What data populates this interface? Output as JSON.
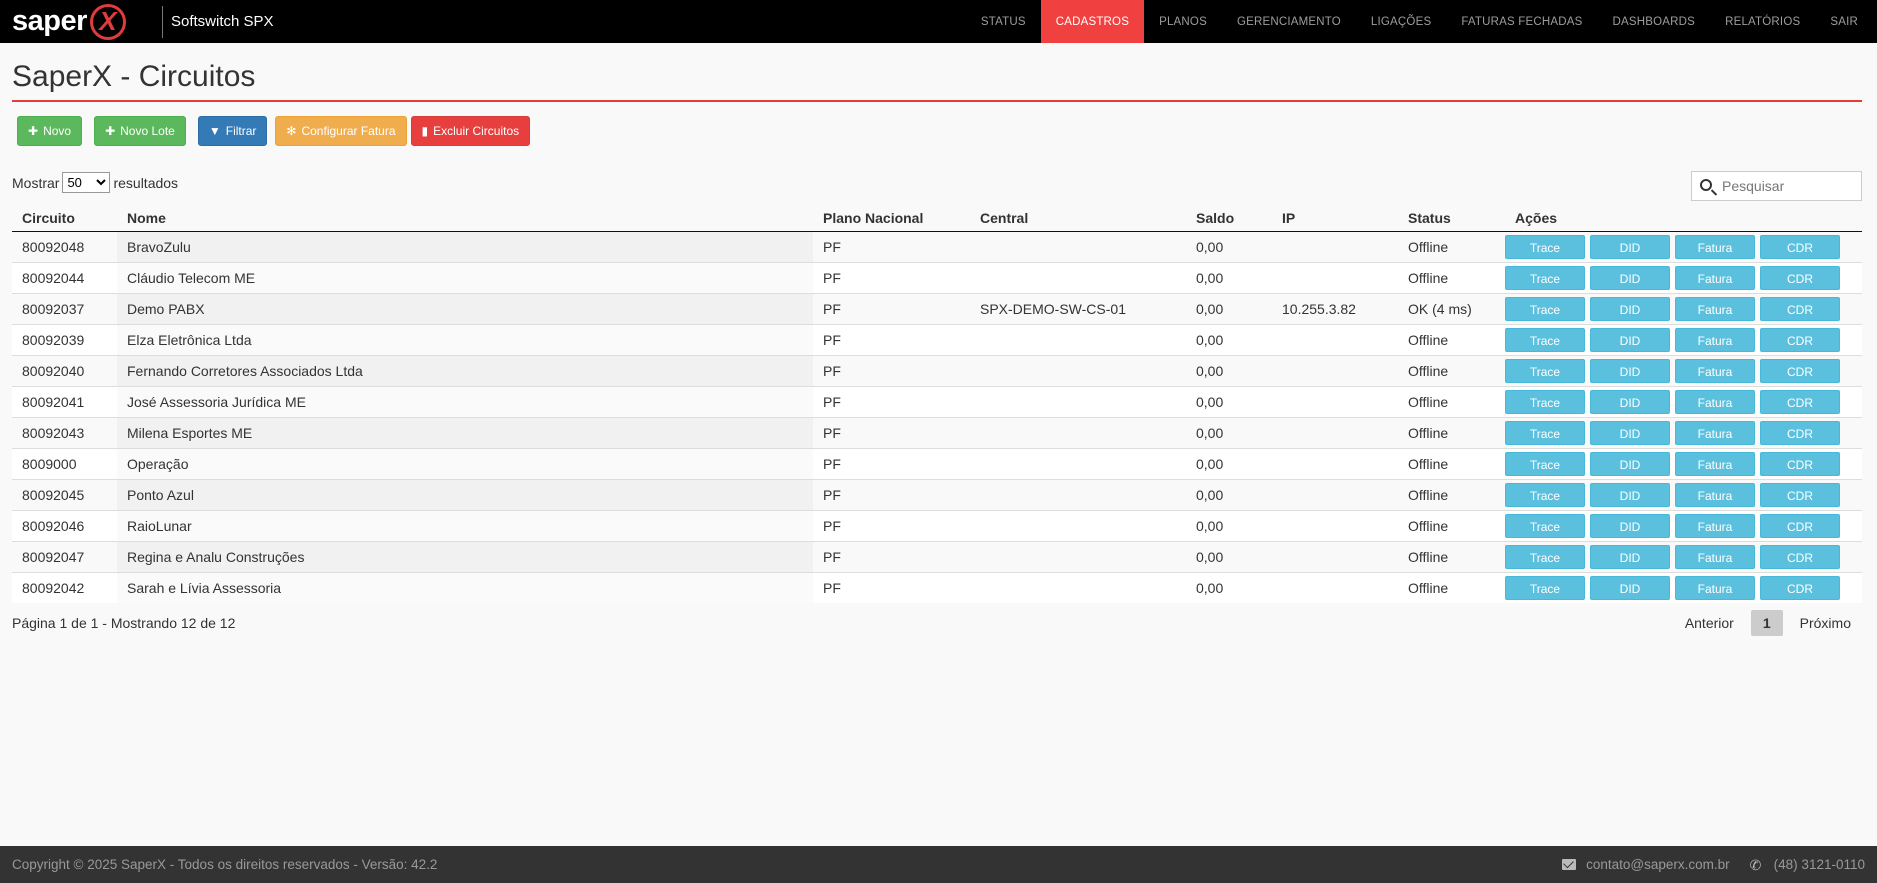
{
  "navbar": {
    "brand": "saper",
    "brand_x": "X",
    "product": "Softswitch SPX",
    "menu": [
      {
        "label": "STATUS",
        "active": false
      },
      {
        "label": "CADASTROS",
        "active": true
      },
      {
        "label": "PLANOS",
        "active": false
      },
      {
        "label": "GERENCIAMENTO",
        "active": false
      },
      {
        "label": "LIGAÇÕES",
        "active": false
      },
      {
        "label": "FATURAS FECHADAS",
        "active": false
      },
      {
        "label": "DASHBOARDS",
        "active": false
      },
      {
        "label": "RELATÓRIOS",
        "active": false
      },
      {
        "label": "SAIR",
        "active": false
      }
    ]
  },
  "page": {
    "title": "SaperX - Circuitos"
  },
  "toolbar": {
    "novo": "Novo",
    "novo_lote": "Novo Lote",
    "filtrar": "Filtrar",
    "configurar_fatura": "Configurar Fatura",
    "excluir_circuitos": "Excluir Circuitos"
  },
  "length": {
    "prefix": "Mostrar",
    "value": "50",
    "suffix": "resultados"
  },
  "search": {
    "placeholder": "Pesquisar"
  },
  "table": {
    "headers": [
      "Circuito",
      "Nome",
      "Plano Nacional",
      "Central",
      "Saldo",
      "IP",
      "Status",
      "Ações"
    ],
    "action_labels": [
      "Trace",
      "DID",
      "Fatura",
      "CDR"
    ],
    "rows": [
      {
        "circuito": "80092048",
        "nome": "BravoZulu",
        "plano": "PF",
        "central": "",
        "saldo": "0,00",
        "ip": "",
        "status": "Offline"
      },
      {
        "circuito": "80092044",
        "nome": "Cláudio Telecom ME",
        "plano": "PF",
        "central": "",
        "saldo": "0,00",
        "ip": "",
        "status": "Offline"
      },
      {
        "circuito": "80092037",
        "nome": "Demo PABX",
        "plano": "PF",
        "central": "SPX-DEMO-SW-CS-01",
        "saldo": "0,00",
        "ip": "10.255.3.82",
        "status": "OK (4 ms)"
      },
      {
        "circuito": "80092039",
        "nome": "Elza Eletrônica Ltda",
        "plano": "PF",
        "central": "",
        "saldo": "0,00",
        "ip": "",
        "status": "Offline"
      },
      {
        "circuito": "80092040",
        "nome": "Fernando Corretores Associados Ltda",
        "plano": "PF",
        "central": "",
        "saldo": "0,00",
        "ip": "",
        "status": "Offline"
      },
      {
        "circuito": "80092041",
        "nome": "José Assessoria Jurídica ME",
        "plano": "PF",
        "central": "",
        "saldo": "0,00",
        "ip": "",
        "status": "Offline"
      },
      {
        "circuito": "80092043",
        "nome": "Milena Esportes ME",
        "plano": "PF",
        "central": "",
        "saldo": "0,00",
        "ip": "",
        "status": "Offline"
      },
      {
        "circuito": "8009000",
        "nome": "Operação",
        "plano": "PF",
        "central": "",
        "saldo": "0,00",
        "ip": "",
        "status": "Offline"
      },
      {
        "circuito": "80092045",
        "nome": "Ponto Azul",
        "plano": "PF",
        "central": "",
        "saldo": "0,00",
        "ip": "",
        "status": "Offline"
      },
      {
        "circuito": "80092046",
        "nome": "RaioLunar",
        "plano": "PF",
        "central": "",
        "saldo": "0,00",
        "ip": "",
        "status": "Offline"
      },
      {
        "circuito": "80092047",
        "nome": "Regina e Analu Construções",
        "plano": "PF",
        "central": "",
        "saldo": "0,00",
        "ip": "",
        "status": "Offline"
      },
      {
        "circuito": "80092042",
        "nome": "Sarah e Lívia Assessoria",
        "plano": "PF",
        "central": "",
        "saldo": "0,00",
        "ip": "",
        "status": "Offline"
      }
    ]
  },
  "pagination": {
    "info": "Página 1 de 1 - Mostrando 12 de 12",
    "previous": "Anterior",
    "current": "1",
    "next": "Próximo"
  },
  "footer": {
    "copyright": "Copyright © 2025 SaperX - Todos os direitos reservados - Versão: 42.2",
    "email": "contato@saperx.com.br",
    "phone": "(48) 3121-0110"
  },
  "colors": {
    "accent": "#f04040",
    "success": "#5cb85c",
    "primary": "#337ab7",
    "warning": "#f0ad4e",
    "info": "#5bc0de"
  }
}
